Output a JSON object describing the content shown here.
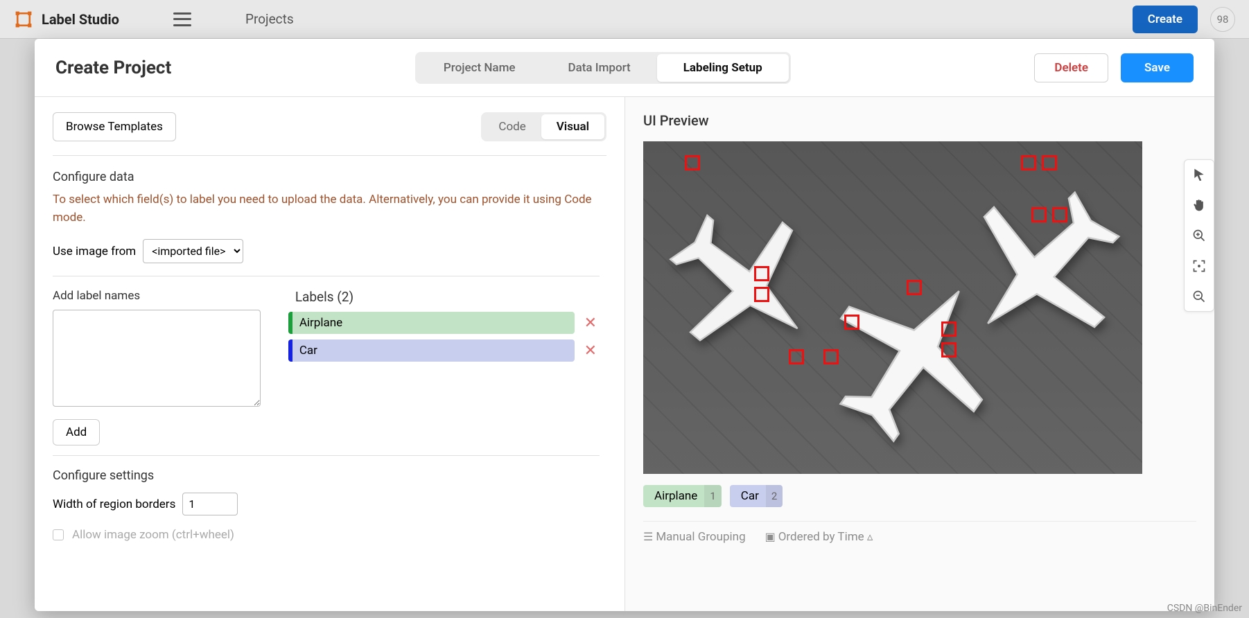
{
  "header": {
    "app_name": "Label Studio",
    "projects_link": "Projects",
    "create_btn": "Create",
    "badge": "98"
  },
  "modal": {
    "title": "Create Project",
    "tabs": {
      "name": "Project Name",
      "import": "Data Import",
      "setup": "Labeling Setup"
    },
    "active_tab": "setup",
    "delete": "Delete",
    "save": "Save"
  },
  "left": {
    "browse": "Browse Templates",
    "code": "Code",
    "visual": "Visual",
    "configure_data": "Configure data",
    "warn": "To select which field(s) to label you need to upload the data. Alternatively, you can provide it using Code mode.",
    "use_image_from": "Use image from",
    "select_value": "<imported file>",
    "add_label_names": "Add label names",
    "labels_heading": "Labels (2)",
    "labels": [
      {
        "name": "Airplane",
        "chip_class": "chip-airplane"
      },
      {
        "name": "Car",
        "chip_class": "chip-car"
      }
    ],
    "add": "Add",
    "configure_settings": "Configure settings",
    "width_label": "Width of region borders",
    "width_value": "1",
    "zoom_label": "Allow image zoom (ctrl+wheel)"
  },
  "right": {
    "preview": "UI Preview",
    "legend": [
      {
        "name": "Airplane",
        "num": "1",
        "chip_class": "chip-airplane"
      },
      {
        "name": "Car",
        "num": "2",
        "chip_class": "chip-car"
      }
    ],
    "manual_grouping": "Manual Grouping",
    "ordered_by_time": "Ordered by Time"
  },
  "watermark": "CSDN @BinEnder"
}
